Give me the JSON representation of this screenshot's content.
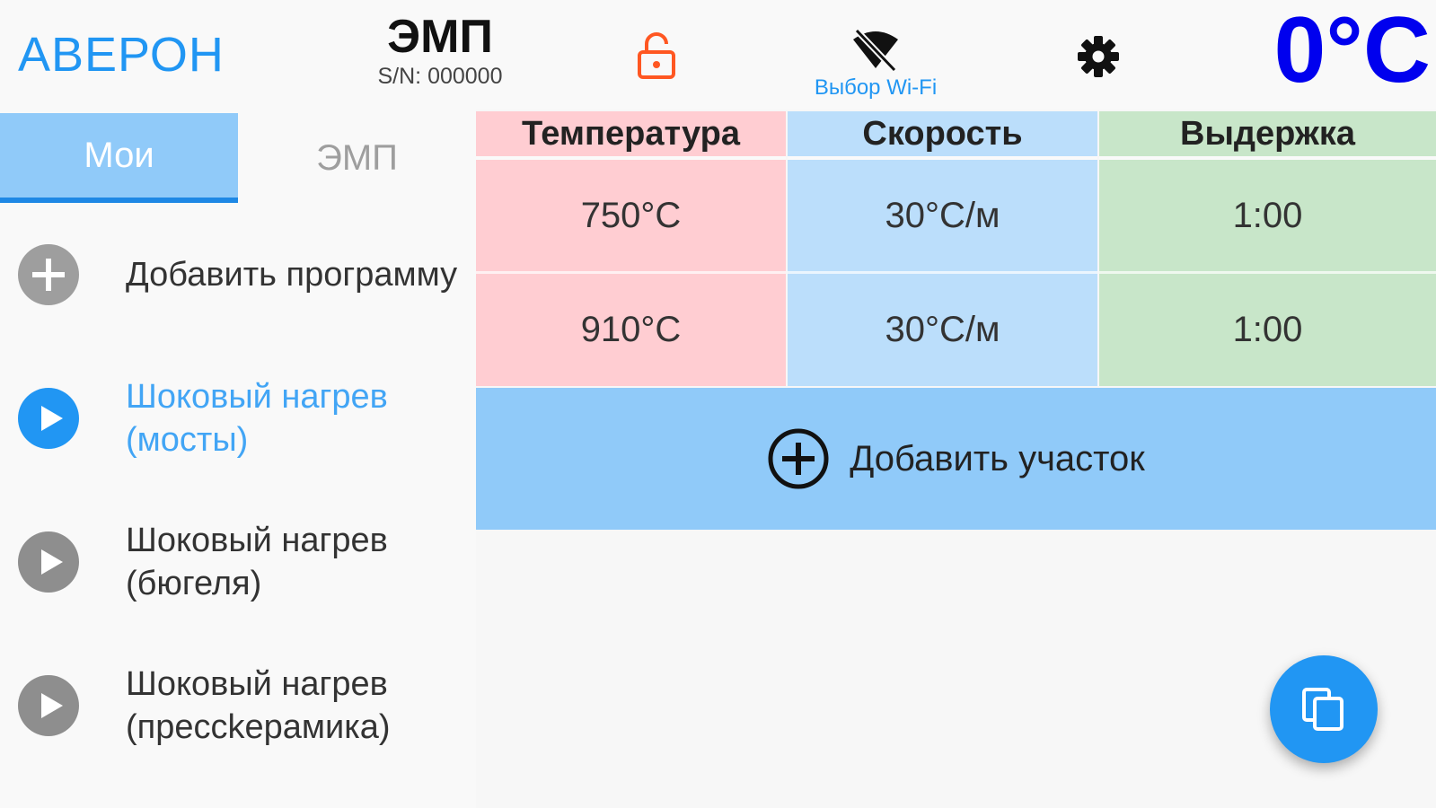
{
  "header": {
    "brand": "АВЕРОН",
    "device_name": "ЭМП",
    "serial": "S/N: 000000",
    "wifi_label": "Выбор Wi-Fi",
    "temperature": "0°C"
  },
  "tabs": [
    {
      "label": "Мои",
      "active": true
    },
    {
      "label": "ЭМП",
      "active": false
    }
  ],
  "programs": [
    {
      "label": "Добавить программу",
      "icon": "add-circle-icon"
    },
    {
      "label": "Шоковый нагрев (мосты)",
      "icon": "play-circle-icon",
      "active": true
    },
    {
      "label": "Шоковый нагрев (бюгеля)",
      "icon": "play-circle-icon"
    },
    {
      "label": "Шоковый нагрев (прессkерамика)",
      "icon": "play-circle-icon"
    }
  ],
  "table": {
    "headers": {
      "temperature": "Температура",
      "speed": "Скорость",
      "hold": "Выдержка"
    },
    "rows": [
      {
        "temperature": "750°C",
        "speed": "30°C/м",
        "hold": "1:00"
      },
      {
        "temperature": "910°C",
        "speed": "30°C/м",
        "hold": "1:00"
      }
    ]
  },
  "add_section_label": "Добавить участок",
  "colors": {
    "accent": "#2196f3",
    "temp_col": "#ffcdd2",
    "speed_col": "#bbdefb",
    "hold_col": "#c8e6c9",
    "lock": "#ff5722",
    "temperature_text": "#0000ee"
  }
}
